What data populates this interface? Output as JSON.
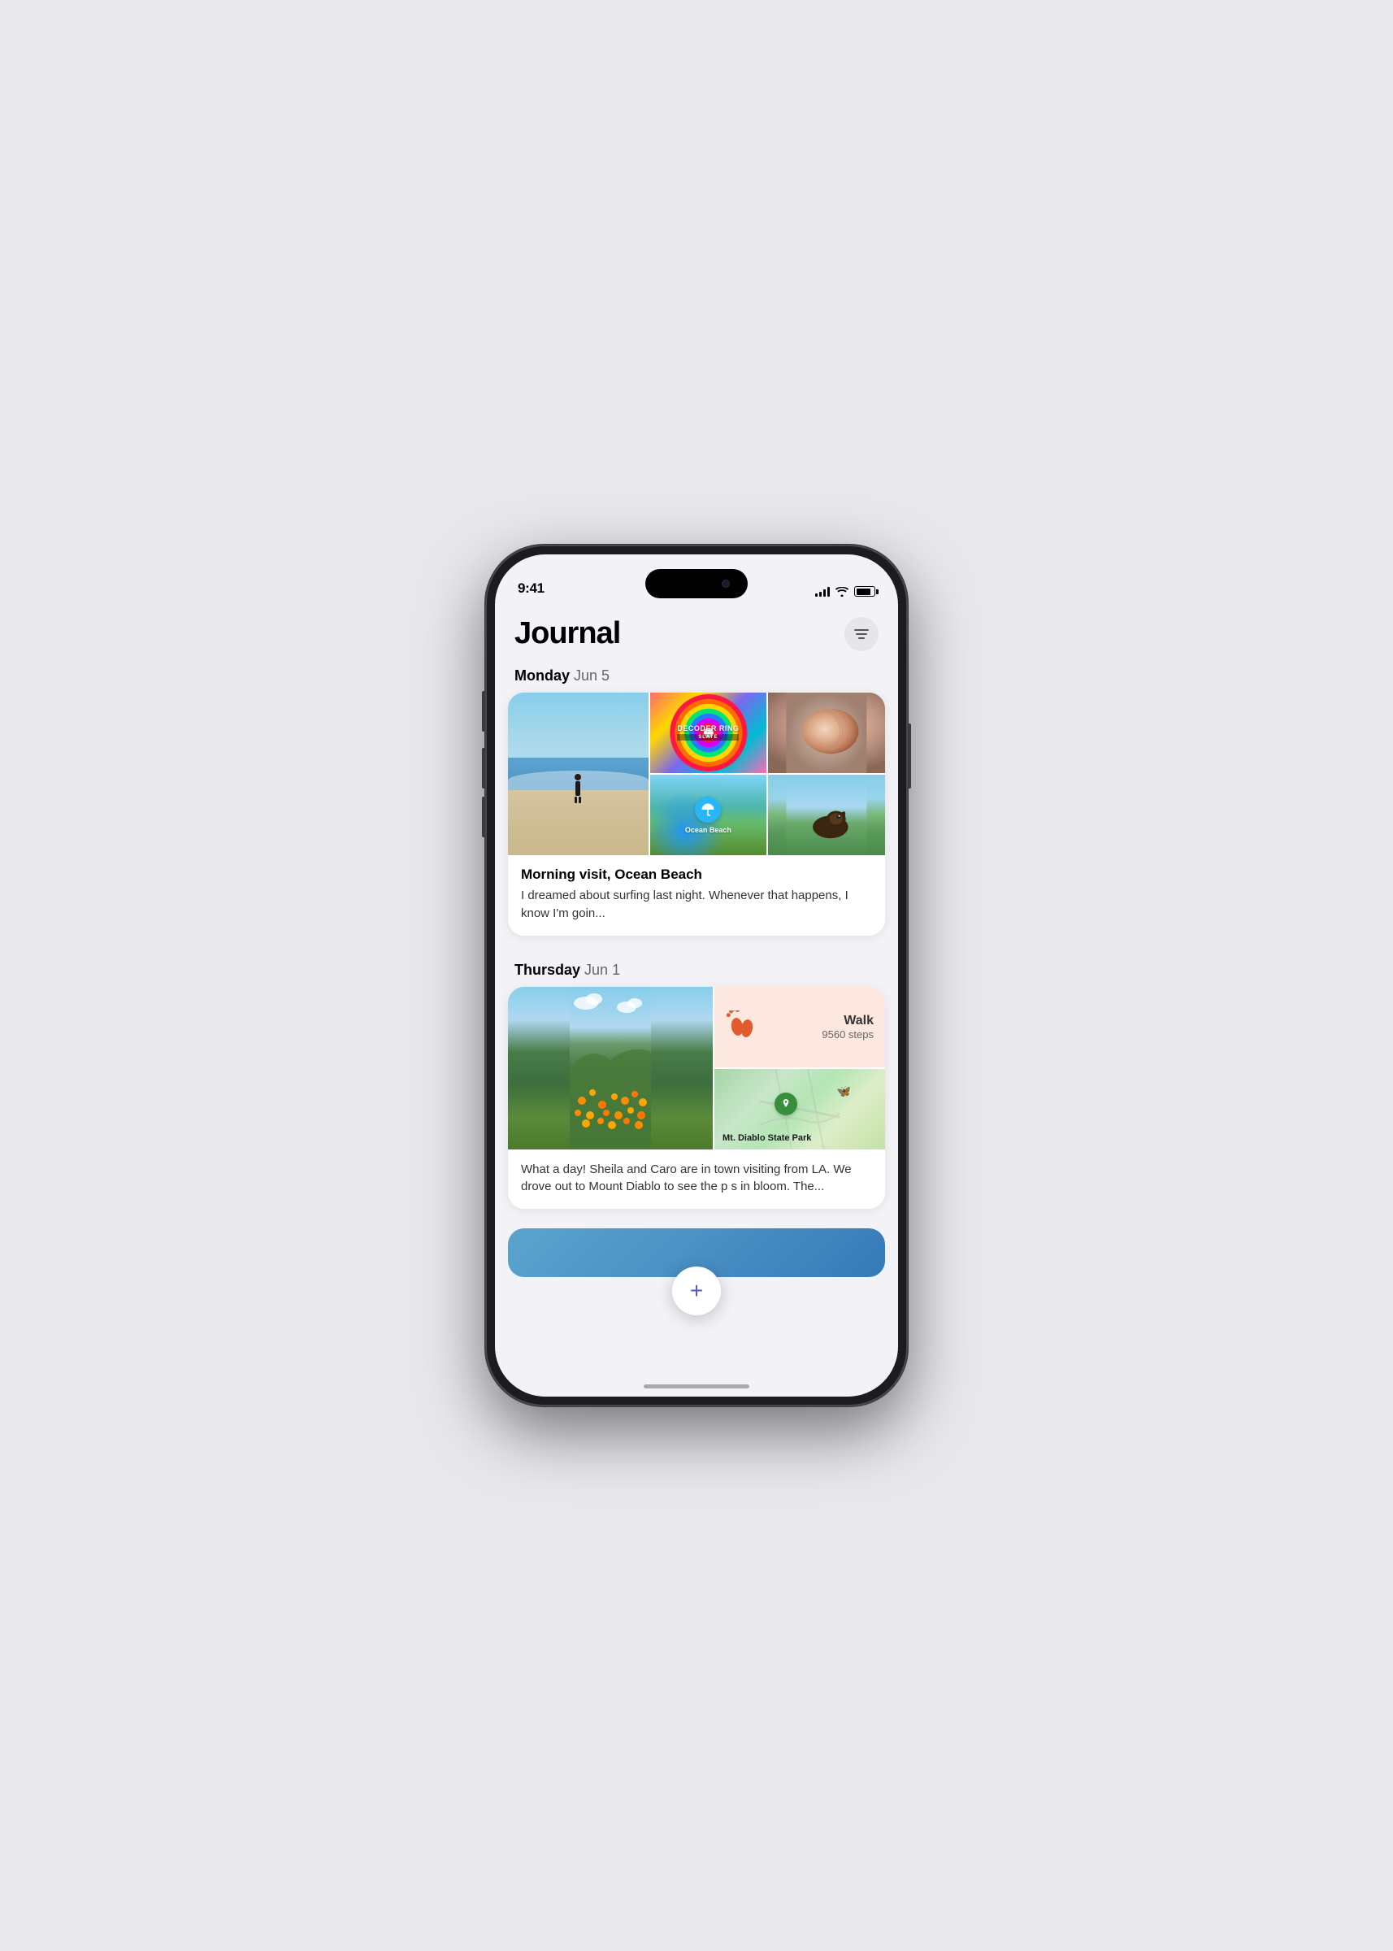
{
  "phone": {
    "status_bar": {
      "time": "9:41"
    }
  },
  "app": {
    "title": "Journal",
    "filter_btn_label": "Filter"
  },
  "entries": [
    {
      "date": "Monday",
      "date_num": "Jun 5",
      "images": [
        "beach",
        "decoder_ring",
        "shell",
        "ocean_beach",
        "dog"
      ],
      "title": "Morning visit, Ocean Beach",
      "body": "I dreamed about surfing last night. Whenever that happens, I know I'm goin..."
    },
    {
      "date": "Thursday",
      "date_num": "Jun 1",
      "images": [
        "flowers",
        "walk",
        "map"
      ],
      "walk_label": "Walk",
      "walk_steps": "9560 steps",
      "map_label": "Mt. Diablo State Park",
      "title": "",
      "body": "What a day! Sheila and Caro are in town visiting from LA. We drove out to Mount Diablo to see the p      s in bloom. The..."
    }
  ],
  "decoder_ring": {
    "title": "DECODER RING",
    "subtitle": "SLATE"
  },
  "ocean_beach": {
    "label": "Ocean Beach"
  },
  "fab": {
    "label": "+"
  }
}
